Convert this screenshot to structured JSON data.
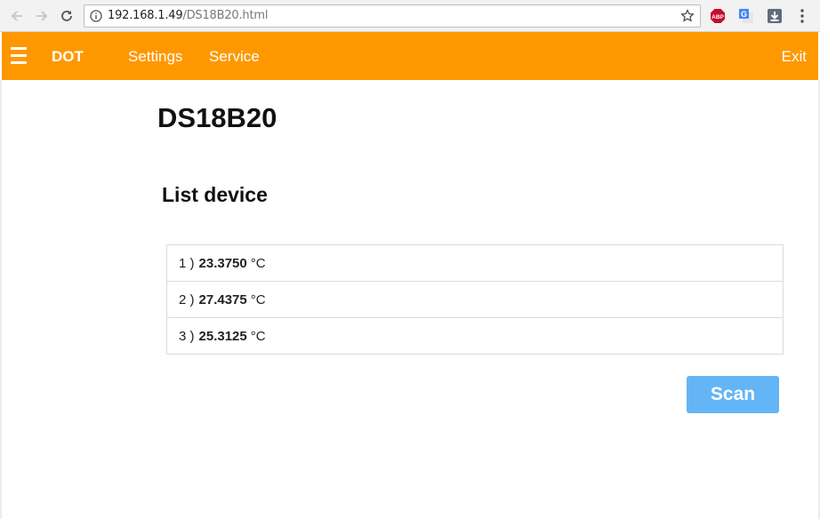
{
  "browser": {
    "url_host": "192.168.1.49",
    "url_path": "/DS18B20.html",
    "extensions": [
      "adblock-plus-icon",
      "google-translate-icon",
      "download-icon",
      "menu-dots-icon"
    ]
  },
  "header": {
    "brand": "DOT",
    "nav": [
      "Settings",
      "Service"
    ],
    "exit": "Exit",
    "color": "#ff9800"
  },
  "main": {
    "title": "DS18B20",
    "section_title": "List device",
    "devices": [
      {
        "index": "1 )",
        "value": "23.3750",
        "unit": "°C"
      },
      {
        "index": "2 )",
        "value": "27.4375",
        "unit": "°C"
      },
      {
        "index": "3 )",
        "value": "25.3125",
        "unit": "°C"
      }
    ],
    "scan_label": "Scan",
    "scan_color": "#64b5f6"
  }
}
